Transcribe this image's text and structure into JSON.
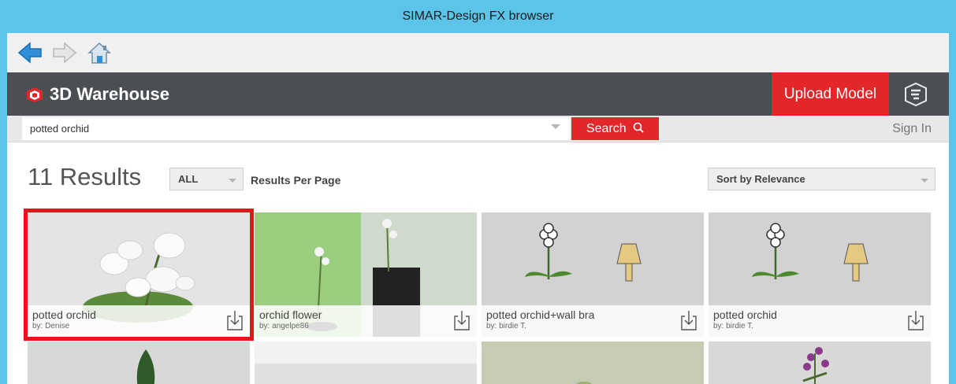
{
  "window": {
    "title": "SIMAR-Design FX browser"
  },
  "nav": {
    "back_icon": "back-arrow-icon",
    "forward_icon": "forward-arrow-icon",
    "home_icon": "home-icon"
  },
  "header": {
    "brand": "3D Warehouse",
    "upload_label": "Upload Model",
    "menu_icon": "sketchup-menu-icon"
  },
  "search": {
    "value": "potted orchid",
    "button_label": "Search",
    "signin_label": "Sign In"
  },
  "results": {
    "count_label": "11 Results",
    "filter_value": "ALL",
    "per_page_label": "Results Per Page",
    "sort_value": "Sort by Relevance",
    "items": [
      {
        "title": "potted orchid",
        "author": "by: Denise"
      },
      {
        "title": "orchid flower",
        "author": "by: angelpe86"
      },
      {
        "title": "potted orchid+wall bra",
        "author": "by: birdie T."
      },
      {
        "title": "potted orchid",
        "author": "by: birdie T."
      }
    ]
  },
  "colors": {
    "titlebar": "#5bc4e8",
    "header": "#4b4f54",
    "accent_red": "#e2262a",
    "highlight": "#e8141c"
  }
}
